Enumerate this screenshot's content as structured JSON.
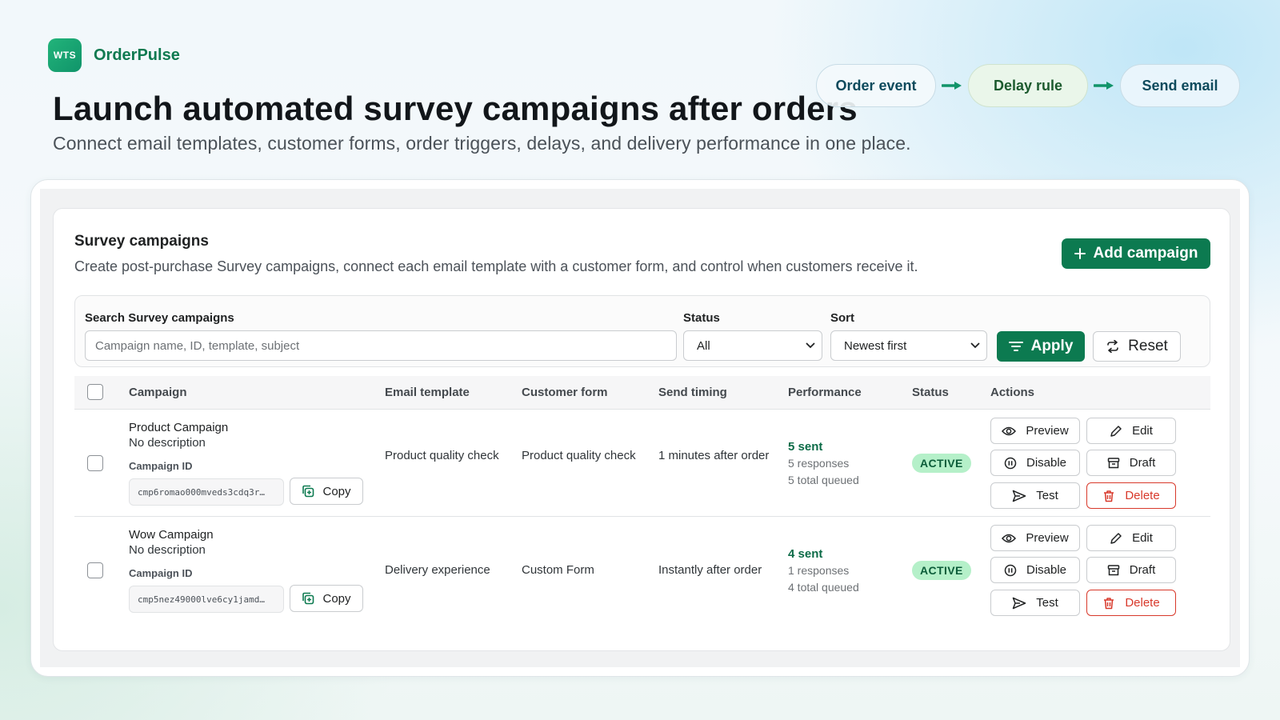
{
  "brand": {
    "logo_text": "WTS",
    "name": "OrderPulse"
  },
  "hero": {
    "title": "Launch automated survey campaigns after orders",
    "subtitle": "Connect email templates, customer forms, order triggers, delays, and delivery performance in one place."
  },
  "flow": {
    "steps": [
      "Order event",
      "Delay rule",
      "Send email"
    ],
    "arrow_icon": "arrow-right-icon"
  },
  "card": {
    "title": "Survey campaigns",
    "description": "Create post-purchase Survey campaigns, connect each email template with a customer form, and control when customers receive it.",
    "add_button": "Add campaign"
  },
  "filters": {
    "search_label": "Search Survey campaigns",
    "search_placeholder": "Campaign name, ID, template, subject",
    "search_value": "",
    "status_label": "Status",
    "status_value": "All",
    "sort_label": "Sort",
    "sort_value": "Newest first",
    "apply_label": "Apply",
    "reset_label": "Reset"
  },
  "table": {
    "columns": [
      "Campaign",
      "Email template",
      "Customer form",
      "Send timing",
      "Performance",
      "Status",
      "Actions"
    ],
    "id_label": "Campaign ID",
    "copy_label": "Copy",
    "actions": {
      "preview": "Preview",
      "edit": "Edit",
      "disable": "Disable",
      "draft": "Draft",
      "test": "Test",
      "delete": "Delete"
    },
    "rows": [
      {
        "name": "Product Campaign",
        "description": "No description",
        "campaign_id": "cmp6romao000mveds3cdq3r…",
        "email_template": "Product quality check",
        "customer_form": "Product quality check",
        "send_timing": "1 minutes after order",
        "sent": "5 sent",
        "responses": "5 responses",
        "queued": "5 total queued",
        "status": "ACTIVE"
      },
      {
        "name": "Wow Campaign",
        "description": "No description",
        "campaign_id": "cmp5nez49000lve6cy1jamd…",
        "email_template": "Delivery experience",
        "customer_form": "Custom Form",
        "send_timing": "Instantly after order",
        "sent": "4 sent",
        "responses": "1 responses",
        "queued": "4 total queued",
        "status": "ACTIVE"
      }
    ]
  },
  "colors": {
    "primary": "#0c7a50",
    "brand_text": "#0f7a50",
    "active_badge_bg": "#b5f0c9",
    "danger": "#d8392b"
  }
}
